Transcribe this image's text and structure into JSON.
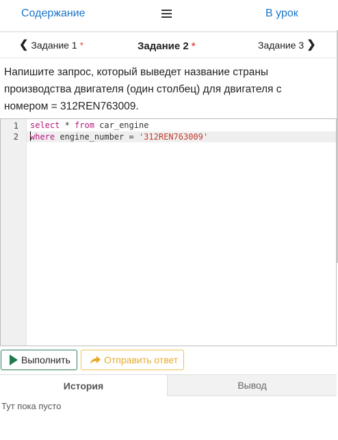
{
  "header": {
    "contents_link": "Содержание",
    "menu_icon": "hamburger-icon",
    "lesson_link": "В урок"
  },
  "task_nav": {
    "prev_label": "Задание 1",
    "prev_star": "*",
    "current_label": "Задание 2",
    "current_star": "*",
    "next_label": "Задание 3"
  },
  "question": {
    "text": "Напишите запрос, который выведет название страны производства двигателя (один столбец) для двигателя с номером = 312REN763009."
  },
  "editor": {
    "line_numbers": [
      "1",
      "2"
    ],
    "line1": {
      "kw1": "select",
      "rest1": " * ",
      "kw2": "from",
      "rest2": " car_engine"
    },
    "line2": {
      "kw1": "where",
      "rest": " engine_number = ",
      "string": "'312REN763009'"
    }
  },
  "actions": {
    "run_label": "Выполнить",
    "send_label": "Отправить ответ",
    "run_color": "#1f7a4d",
    "send_color": "#e8a929"
  },
  "tabs": {
    "history": "История",
    "output": "Вывод"
  },
  "history": {
    "empty_text": "Тут пока пусто"
  }
}
